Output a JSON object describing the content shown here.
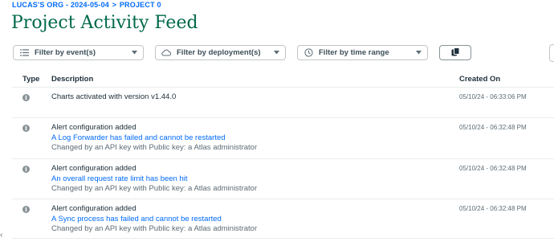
{
  "breadcrumb": {
    "org": "LUCAS'S ORG - 2024-05-04",
    "separator": ">",
    "project": "PROJECT 0"
  },
  "page_title": "Project Activity Feed",
  "filters": {
    "event": "Filter by event(s)",
    "deployment": "Filter by deployment(s)",
    "time_range": "Filter by time range"
  },
  "table": {
    "columns": {
      "type": "Type",
      "description": "Description",
      "created_on": "Created On"
    },
    "rows": [
      {
        "main": "Charts activated with version v1.44.0",
        "link": "",
        "sub": "",
        "date": "05/10/24 - 06:33:06 PM"
      },
      {
        "main": "Alert configuration added",
        "link": "A Log Forwarder has failed and cannot be restarted",
        "sub": "Changed by an API key with Public key: a Atlas administrator",
        "date": "05/10/24 - 06:32:48 PM"
      },
      {
        "main": "Alert configuration added",
        "link": "An overall request rate limit has been hit",
        "sub": "Changed by an API key with Public key: a Atlas administrator",
        "date": "05/10/24 - 06:32:48 PM"
      },
      {
        "main": "Alert configuration added",
        "link": "A Sync process has failed and cannot be restarted",
        "sub": "Changed by an API key with Public key: a Atlas administrator",
        "date": "05/10/24 - 06:32:48 PM"
      }
    ]
  },
  "icons": {
    "filter_event": "list-filter-icon",
    "filter_deployment": "cloud-icon",
    "filter_time": "clock-icon",
    "copy": "copy-icon",
    "row_type": "info-icon"
  },
  "colors": {
    "breadcrumb": "#016bf8",
    "title": "#00684a",
    "link": "#016bf8"
  }
}
